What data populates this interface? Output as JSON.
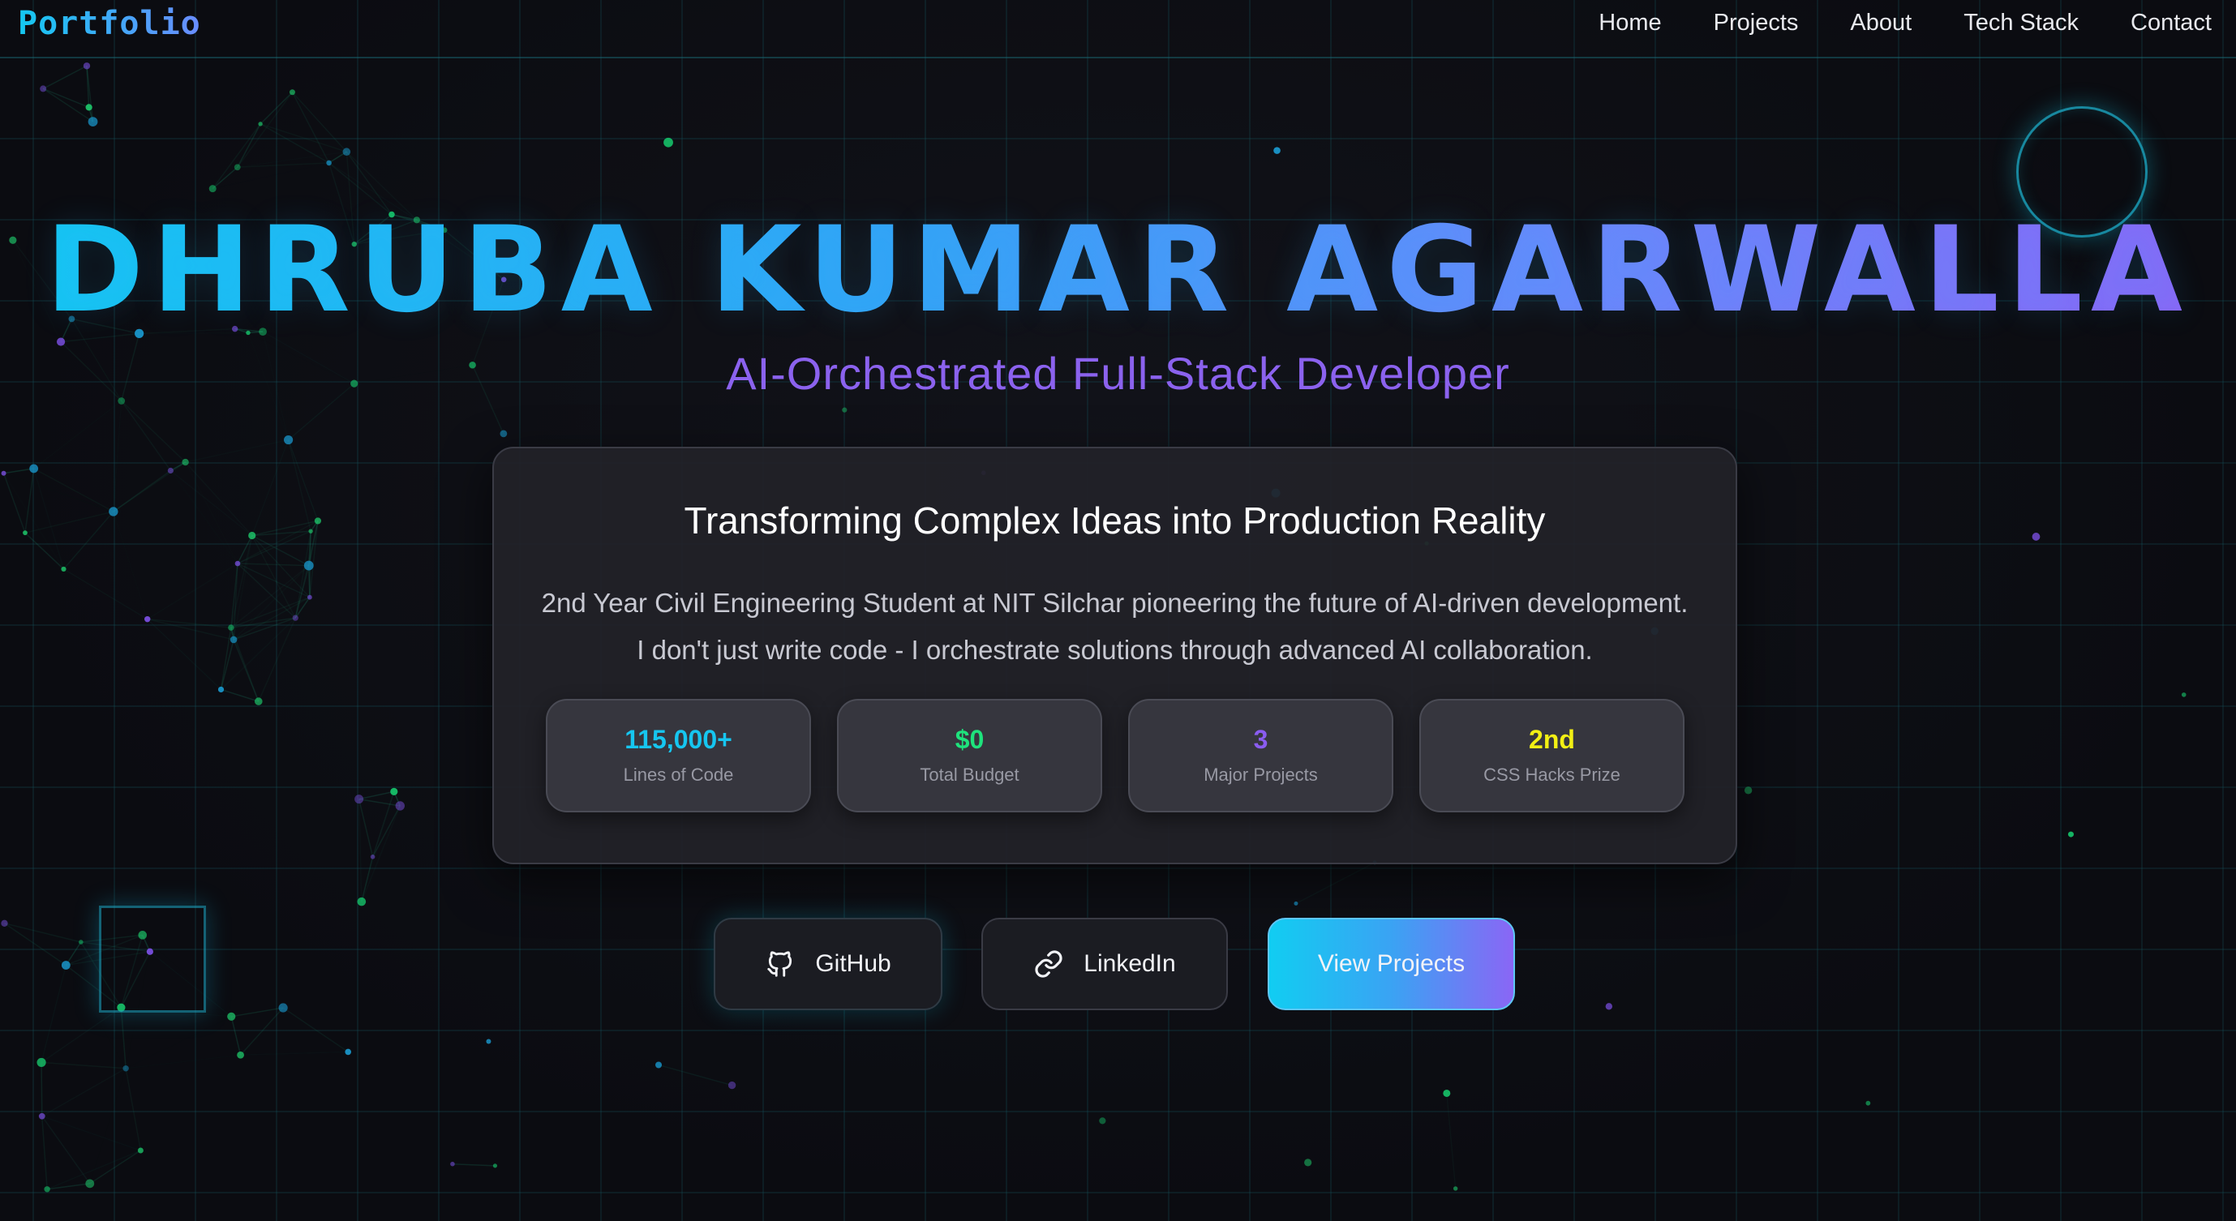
{
  "nav": {
    "logo": "Portfolio",
    "links": [
      "Home",
      "Projects",
      "About",
      "Tech Stack",
      "Contact"
    ]
  },
  "hero": {
    "name": "DHRUBA KUMAR AGARWALLA",
    "subtitle": "AI-Orchestrated Full-Stack Developer"
  },
  "card": {
    "title": "Transforming Complex Ideas into Production Reality",
    "description_line1": "2nd Year Civil Engineering Student at NIT Silchar pioneering the future of AI-driven development.",
    "description_line2": "I don't just write code - I orchestrate solutions through advanced AI collaboration.",
    "stats": [
      {
        "value": "115,000+",
        "label": "Lines of Code",
        "color": "#16c6f0"
      },
      {
        "value": "$0",
        "label": "Total Budget",
        "color": "#1ee37c"
      },
      {
        "value": "3",
        "label": "Major Projects",
        "color": "#8a5cf0"
      },
      {
        "value": "2nd",
        "label": "CSS Hacks Prize",
        "color": "#f2ef14"
      }
    ]
  },
  "buttons": {
    "github": {
      "label": "GitHub",
      "icon": "github-icon"
    },
    "linkedin": {
      "label": "LinkedIn",
      "icon": "link-icon"
    },
    "projects": {
      "label": "View Projects"
    }
  },
  "colors": {
    "accent_cyan": "#14c6f2",
    "accent_purple": "#8c64f6",
    "background": "#0c0d12"
  }
}
